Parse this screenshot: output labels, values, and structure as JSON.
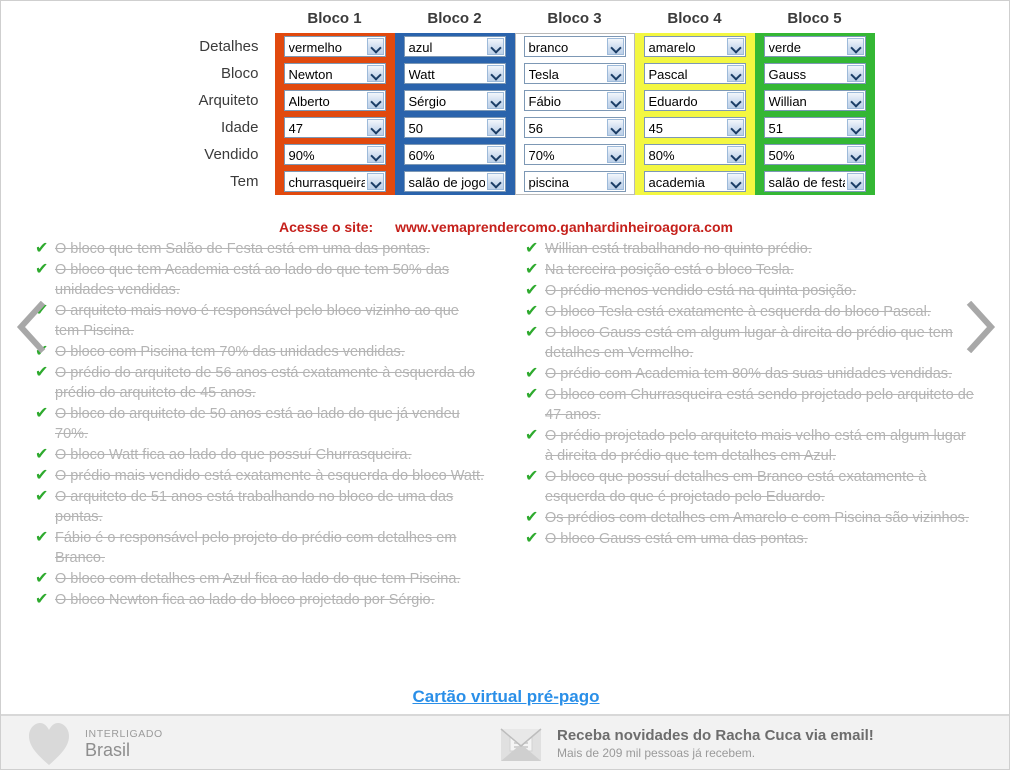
{
  "grid": {
    "column_headers": [
      "Bloco 1",
      "Bloco 2",
      "Bloco 3",
      "Bloco 4",
      "Bloco 5"
    ],
    "row_labels": [
      "Detalhes",
      "Bloco",
      "Arquiteto",
      "Idade",
      "Vendido",
      "Tem"
    ],
    "column_colors": [
      "#e1490e",
      "#2a63ac",
      "#ffffff",
      "#f3f741",
      "#34b734"
    ],
    "rows": [
      {
        "label": "Detalhes",
        "values": [
          "vermelho",
          "azul",
          "branco",
          "amarelo",
          "verde"
        ]
      },
      {
        "label": "Bloco",
        "values": [
          "Newton",
          "Watt",
          "Tesla",
          "Pascal",
          "Gauss"
        ]
      },
      {
        "label": "Arquiteto",
        "values": [
          "Alberto",
          "Sérgio",
          "Fábio",
          "Eduardo",
          "Willian"
        ]
      },
      {
        "label": "Idade",
        "values": [
          "47",
          "50",
          "56",
          "45",
          "51"
        ]
      },
      {
        "label": "Vendido",
        "values": [
          "90%",
          "60%",
          "70%",
          "80%",
          "50%"
        ]
      },
      {
        "label": "Tem",
        "values": [
          "churrasqueira",
          "salão de jogos",
          "piscina",
          "academia",
          "salão de festas"
        ]
      }
    ]
  },
  "site_line": {
    "label": "Acesse o site:",
    "url": "www.vemaprendercomo.ganhardinheiroagora.com",
    "color": "#c5201b"
  },
  "clues": {
    "left": [
      "O bloco que tem Salão de Festa está em uma das pontas.",
      "O bloco que tem Academia está ao lado do que tem 50% das unidades vendidas.",
      "O arquiteto mais novo é responsável pelo bloco vizinho ao que tem Piscina.",
      "O bloco com Piscina tem 70% das unidades vendidas.",
      "O prédio do arquiteto de 56 anos está exatamente à esquerda do prédio do arquiteto de 45 anos.",
      "O bloco do arquiteto de 50 anos está ao lado do que já vendeu 70%.",
      "O bloco Watt fica ao lado do que possuí Churrasqueira.",
      "O prédio mais vendido está exatamente à esquerda do bloco Watt.",
      "O arquiteto de 51 anos está trabalhando no bloco de uma das pontas.",
      "Fábio é o responsável pelo projeto do prédio com detalhes em Branco.",
      "O bloco com detalhes em Azul fica ao lado do que tem Piscina.",
      "O bloco Newton fica ao lado do bloco projetado por Sérgio."
    ],
    "right": [
      "Willian está trabalhando no quinto prédio.",
      "Na terceira posição está o bloco Tesla.",
      "O prédio menos vendido está na quinta posição.",
      "O bloco Tesla está exatamente à esquerda do bloco Pascal.",
      "O bloco Gauss está em algum lugar à direita do prédio que tem detalhes em Vermelho.",
      "O prédio com Academia tem 80% das suas unidades vendidas.",
      "O bloco com Churrasqueira está sendo projetado pelo arquiteto de 47 anos.",
      "O prédio projetado pelo arquiteto mais velho está em algum lugar à direita do prédio que tem detalhes em Azul.",
      "O bloco que possuí detalhes em Branco está exatamente à esquerda do que é projetado pelo Eduardo.",
      "Os prédios com detalhes em Amarelo e com Piscina são vizinhos.",
      "O bloco Gauss está em uma das pontas."
    ],
    "check_glyph": "✔",
    "check_color": "#2eaa2e"
  },
  "nav": {
    "prev_icon": "chevron-left-icon",
    "next_icon": "chevron-right-icon"
  },
  "promo": {
    "link_text": "Cartão virtual pré-pago",
    "link_color": "#2a8fe8"
  },
  "footer": {
    "left": {
      "icon": "heart-icon",
      "small_text": "INTERLIGADO",
      "big_text": "Brasil"
    },
    "right": {
      "icon": "envelope-icon",
      "title": "Receba novidades do Racha Cuca via email!",
      "subtitle": "Mais de 209 mil pessoas já recebem."
    }
  }
}
